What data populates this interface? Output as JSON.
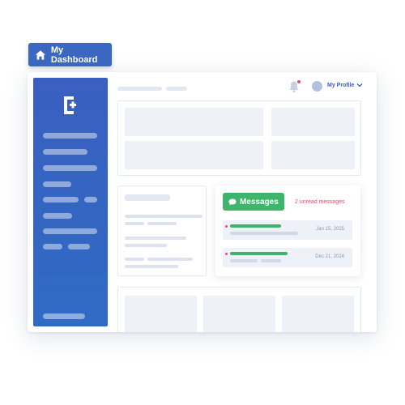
{
  "dashboard_tag": {
    "label": "My Dashboard",
    "icon": "home-icon"
  },
  "header": {
    "profile_label": "My Profile",
    "icons": [
      "bell-icon",
      "avatar",
      "chevron-down-icon"
    ],
    "notification_dot_color": "#e0506a"
  },
  "sidebar": {
    "logo": "logo-icon",
    "bg_color": "#3a5fc0"
  },
  "messages": {
    "button_label": "Messages",
    "unread_label": "2 unread messages",
    "items": [
      {
        "date": "Jan 15, 2025"
      },
      {
        "date": "Dec 21, 2024"
      }
    ],
    "accent_color": "#3fb46b"
  },
  "colors": {
    "primary": "#3a67c2",
    "accent_green": "#3fb46b",
    "alert_red": "#e0506a"
  }
}
